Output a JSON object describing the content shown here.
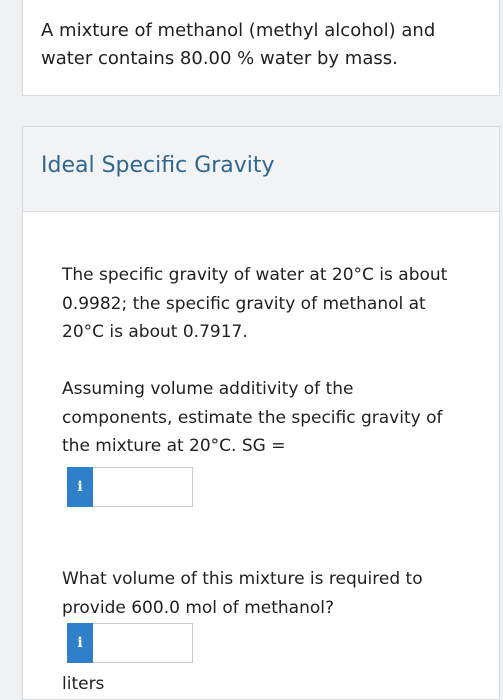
{
  "intro": {
    "text": "A mixture of methanol (methyl alcohol) and water contains 80.00 % water by mass."
  },
  "section": {
    "title": "Ideal Specific Gravity",
    "paragraph1": "The specific gravity of water at 20°C is about 0.9982; the specific gravity of methanol at 20°C is about 0.7917.",
    "paragraph2": "Assuming volume additivity of the components, estimate the specific gravity of the mixture at 20°C. SG =",
    "field1": {
      "info_icon": "i",
      "value": ""
    },
    "paragraph3": "What volume of this mixture is required to provide 600.0 mol of methanol?",
    "field2": {
      "info_icon": "i",
      "value": ""
    },
    "unit": "liters"
  },
  "colors": {
    "title": "#2f6690",
    "info_badge": "#2f80c9"
  }
}
